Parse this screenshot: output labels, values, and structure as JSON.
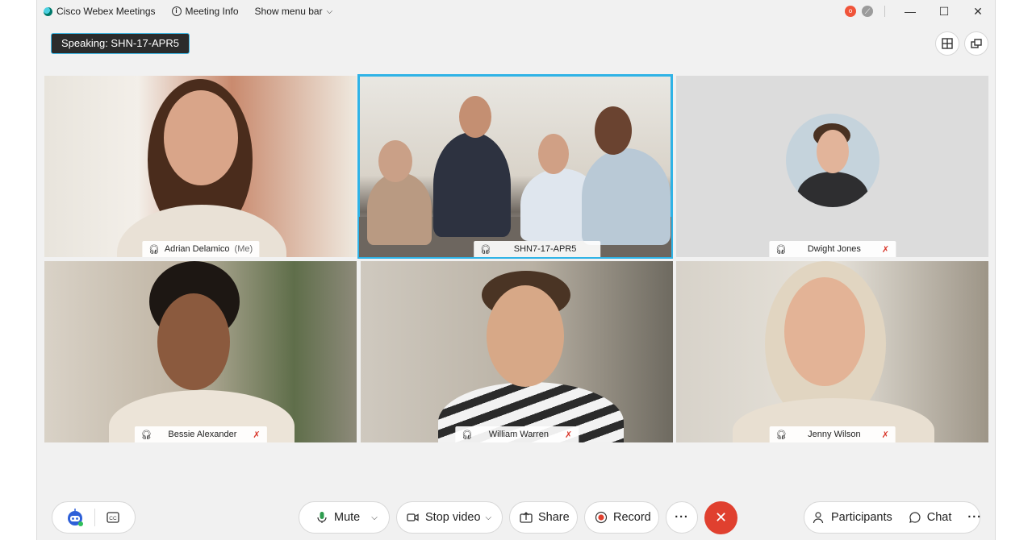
{
  "titlebar": {
    "app_name": "Cisco Webex Meetings",
    "meeting_info": "Meeting Info",
    "show_menu_bar": "Show menu bar",
    "notif_badge": "o"
  },
  "speaking": "Speaking: SHN-17-APR5",
  "tiles": [
    {
      "name": "Adrian Delamico",
      "suffix": "(Me)"
    },
    {
      "name": "SHN7-17-APR5"
    },
    {
      "name": "Dwight Jones"
    },
    {
      "name": "Bessie Alexander"
    },
    {
      "name": "William Warren"
    },
    {
      "name": "Jenny Wilson"
    }
  ],
  "controls": {
    "mute": "Mute",
    "stop_video": "Stop video",
    "share": "Share",
    "record": "Record",
    "more": "···",
    "participants": "Participants",
    "chat": "Chat",
    "more_right": "···"
  },
  "colors": {
    "accent": "#2fb3e6",
    "end_call": "#e0402f",
    "muted": "#d9382c",
    "mic_green": "#2e9c4f"
  }
}
